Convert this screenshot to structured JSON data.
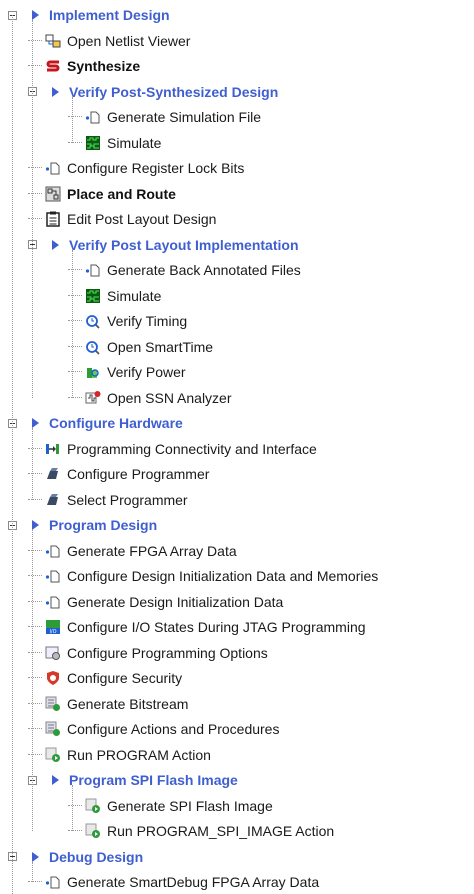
{
  "colors": {
    "group_label": "#3f5fd0",
    "tree_line": "#9a9a9a",
    "text": "#1a1a1a"
  },
  "items": [
    {
      "label": "Implement Design",
      "type": "group",
      "level": 0,
      "expander": true,
      "icon": "triangle-icon"
    },
    {
      "label": "Open Netlist Viewer",
      "type": "item",
      "level": 1,
      "icon": "netlist-viewer-icon"
    },
    {
      "label": "Synthesize",
      "type": "bold",
      "level": 1,
      "icon": "synthesize-icon"
    },
    {
      "label": "Verify Post-Synthesized Design",
      "type": "group",
      "level": 1,
      "expander": true,
      "icon": "triangle-icon"
    },
    {
      "label": "Generate Simulation File",
      "type": "item",
      "level": 2,
      "icon": "document-icon"
    },
    {
      "label": "Simulate",
      "type": "item",
      "level": 2,
      "icon": "waveform-icon"
    },
    {
      "label": "Configure Register Lock Bits",
      "type": "item",
      "level": 1,
      "icon": "document-icon"
    },
    {
      "label": "Place and Route",
      "type": "bold",
      "level": 1,
      "icon": "place-route-icon"
    },
    {
      "label": "Edit Post Layout Design",
      "type": "item",
      "level": 1,
      "icon": "clipboard-icon"
    },
    {
      "label": "Verify Post Layout Implementation",
      "type": "group",
      "level": 1,
      "expander": true,
      "icon": "triangle-icon"
    },
    {
      "label": "Generate Back Annotated Files",
      "type": "item",
      "level": 2,
      "icon": "document-icon"
    },
    {
      "label": "Simulate",
      "type": "item",
      "level": 2,
      "icon": "waveform-icon"
    },
    {
      "label": "Verify Timing",
      "type": "item",
      "level": 2,
      "icon": "timing-icon"
    },
    {
      "label": "Open SmartTime",
      "type": "item",
      "level": 2,
      "icon": "timing-icon"
    },
    {
      "label": "Verify Power",
      "type": "item",
      "level": 2,
      "icon": "power-icon"
    },
    {
      "label": "Open SSN Analyzer",
      "type": "item",
      "level": 2,
      "icon": "ssn-analyzer-icon"
    },
    {
      "label": "Configure Hardware",
      "type": "group",
      "level": 0,
      "expander": true,
      "icon": "triangle-icon"
    },
    {
      "label": "Programming Connectivity and Interface",
      "type": "item",
      "level": 1,
      "icon": "connectivity-icon"
    },
    {
      "label": "Configure Programmer",
      "type": "item",
      "level": 1,
      "icon": "programmer-icon"
    },
    {
      "label": "Select Programmer",
      "type": "item",
      "level": 1,
      "icon": "programmer-icon"
    },
    {
      "label": "Program Design",
      "type": "group",
      "level": 0,
      "expander": true,
      "icon": "triangle-icon"
    },
    {
      "label": "Generate FPGA Array Data",
      "type": "item",
      "level": 1,
      "icon": "document-icon"
    },
    {
      "label": "Configure Design Initialization Data and Memories",
      "type": "item",
      "level": 1,
      "icon": "document-icon"
    },
    {
      "label": "Generate Design Initialization Data",
      "type": "item",
      "level": 1,
      "icon": "document-icon"
    },
    {
      "label": "Configure I/O States During JTAG Programming",
      "type": "item",
      "level": 1,
      "icon": "io-states-icon"
    },
    {
      "label": "Configure Programming Options",
      "type": "item",
      "level": 1,
      "icon": "options-icon"
    },
    {
      "label": "Configure Security",
      "type": "item",
      "level": 1,
      "icon": "security-icon"
    },
    {
      "label": "Generate Bitstream",
      "type": "item",
      "level": 1,
      "icon": "bitstream-icon"
    },
    {
      "label": "Configure Actions and Procedures",
      "type": "item",
      "level": 1,
      "icon": "bitstream-icon"
    },
    {
      "label": "Run PROGRAM Action",
      "type": "item",
      "level": 1,
      "icon": "run-action-icon"
    },
    {
      "label": "Program SPI Flash Image",
      "type": "group",
      "level": 1,
      "expander": true,
      "icon": "triangle-icon"
    },
    {
      "label": "Generate SPI Flash Image",
      "type": "item",
      "level": 2,
      "icon": "run-action-icon"
    },
    {
      "label": "Run PROGRAM_SPI_IMAGE Action",
      "type": "item",
      "level": 2,
      "icon": "run-action-icon"
    },
    {
      "label": "Debug Design",
      "type": "group",
      "level": 0,
      "expander": true,
      "icon": "triangle-icon"
    },
    {
      "label": "Generate SmartDebug FPGA Array Data",
      "type": "item",
      "level": 1,
      "icon": "document-icon"
    }
  ]
}
